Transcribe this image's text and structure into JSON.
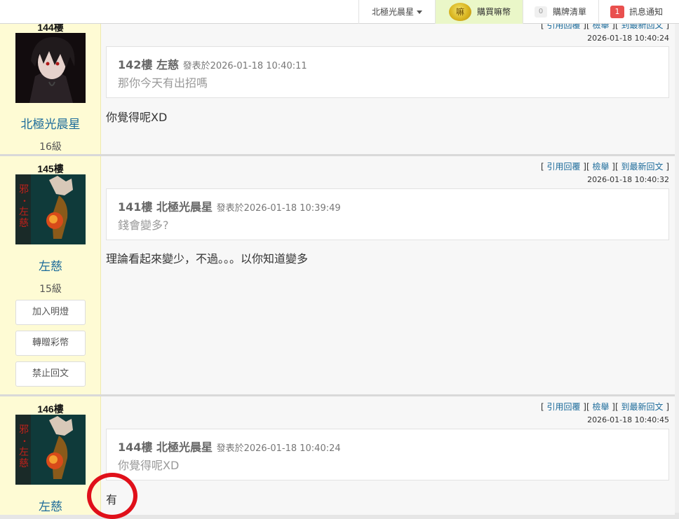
{
  "topbar": {
    "user_menu": "北極光晨星",
    "buy_coin_icon_text": "嘛",
    "buy_label": "購買嘛幣",
    "list_count": "0",
    "list_label": "購牌清單",
    "msg_count": "1",
    "msg_label": "訊息通知"
  },
  "posts": [
    {
      "floor": "144樓",
      "username": "北極光晨星",
      "level": "16級",
      "actions": [
        "引用回覆",
        "檢舉",
        "到最新回文"
      ],
      "time": "2026-01-18 10:40:24",
      "quote": {
        "floor": "142樓",
        "author": "左慈",
        "meta": "發表於2026-01-18 10:40:11",
        "text": "那你今天有出招嗎"
      },
      "text": "你覺得呢XD"
    },
    {
      "floor": "145樓",
      "username": "左慈",
      "level": "15級",
      "buttons": [
        "加入明燈",
        "轉贈彩幣",
        "禁止回文"
      ],
      "actions": [
        "引用回覆",
        "檢舉",
        "到最新回文"
      ],
      "time": "2026-01-18 10:40:32",
      "quote": {
        "floor": "141樓",
        "author": "北極光晨星",
        "meta": "發表於2026-01-18 10:39:49",
        "text": "錢會變多?"
      },
      "text": "理論看起來變少，不過。。。以你知道變多"
    },
    {
      "floor": "146樓",
      "username": "左慈",
      "actions": [
        "引用回覆",
        "檢舉",
        "到最新回文"
      ],
      "time": "2026-01-18 10:40:45",
      "quote": {
        "floor": "144樓",
        "author": "北極光晨星",
        "meta": "發表於2026-01-18 10:40:24",
        "text": "你覺得呢XD"
      },
      "text": "有"
    }
  ],
  "avatar_text": [
    "邪",
    "・",
    "左",
    "慈"
  ],
  "colors": {
    "accent_link": "#1a6a9a",
    "sidebar_bg": "#fefbd4",
    "highlight_circle": "#e0101a",
    "notify_badge": "#e9504e"
  }
}
